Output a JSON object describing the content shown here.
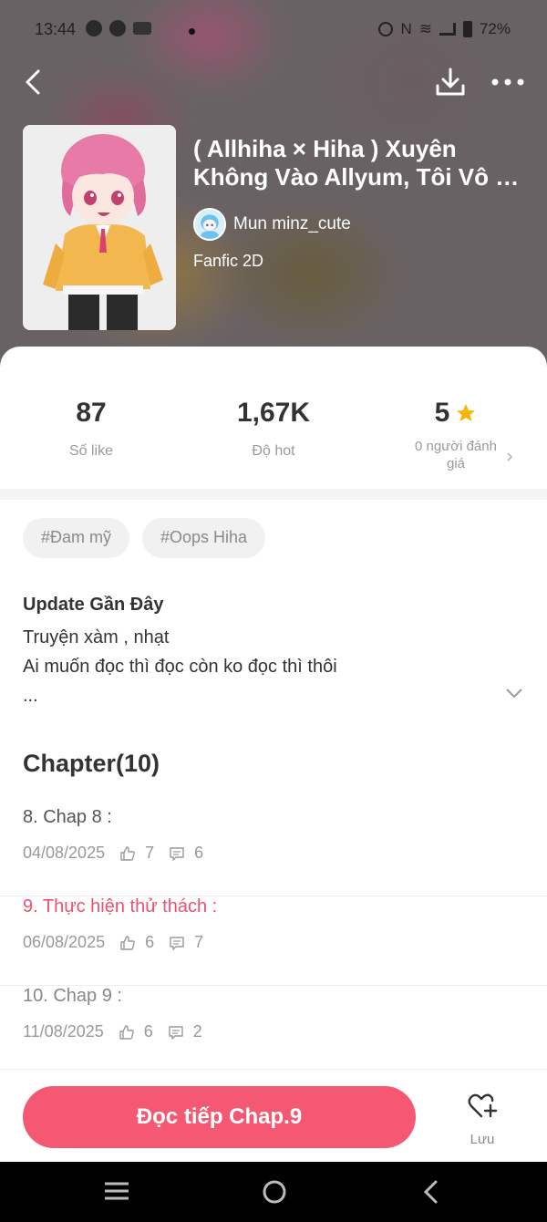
{
  "status_bar": {
    "time": "13:44",
    "battery": "72%"
  },
  "story": {
    "title_line1": "( Allhiha × Hiha ) Xuyên",
    "title_line2": "Không Vào Allyum, Tôi Vô Tình",
    "author": "Mun minz_cute",
    "genre": "Fanfic 2D"
  },
  "stats": {
    "likes_value": "87",
    "likes_label": "Số like",
    "hot_value": "1,67K",
    "hot_label": "Độ hot",
    "rating_value": "5",
    "rating_label": "0 người đánh giá"
  },
  "tags": [
    "#Đam mỹ",
    "#Oops Hiha"
  ],
  "update": {
    "title": "Update Gần Đây",
    "line1": "Truyện xàm , nhạt",
    "line2": "Ai muốn đọc thì đọc còn ko đọc thì thôi",
    "line3": "..."
  },
  "chapters_header": "Chapter(10)",
  "chapters": [
    {
      "name": "8. Chap 8 :",
      "date": "04/08/2025",
      "likes": "7",
      "comments": "6"
    },
    {
      "name": "9. Thực hiện thử thách :",
      "date": "06/08/2025",
      "likes": "6",
      "comments": "7"
    },
    {
      "name": "10. Chap 9 :",
      "date": "11/08/2025",
      "likes": "6",
      "comments": "2"
    }
  ],
  "bottom": {
    "read_label": "Đọc tiếp Chap.9",
    "save_label": "Lưu"
  },
  "colors": {
    "accent": "#f55872",
    "active_chapter": "#f0506e",
    "star": "#f7b500"
  },
  "icons": [
    "back-icon",
    "download-icon",
    "more-icon",
    "star-icon",
    "chevron-right-icon",
    "chevron-down-icon",
    "thumb-up-icon",
    "comment-icon",
    "heart-plus-icon",
    "nav-menu-icon",
    "nav-home-icon",
    "nav-back-icon"
  ]
}
